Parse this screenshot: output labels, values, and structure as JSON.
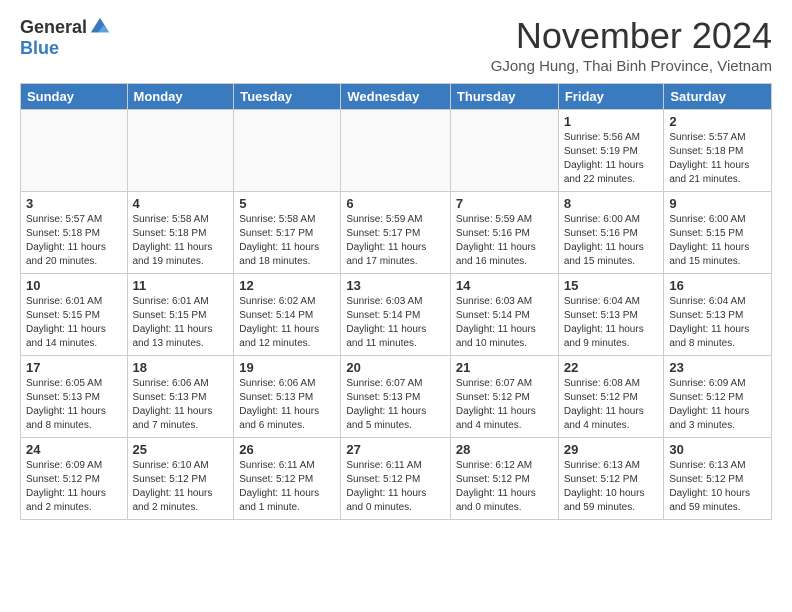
{
  "logo": {
    "general": "General",
    "blue": "Blue"
  },
  "header": {
    "month": "November 2024",
    "location": "GJong Hung, Thai Binh Province, Vietnam"
  },
  "days_of_week": [
    "Sunday",
    "Monday",
    "Tuesday",
    "Wednesday",
    "Thursday",
    "Friday",
    "Saturday"
  ],
  "weeks": [
    {
      "days": [
        {
          "num": "",
          "info": "",
          "empty": true
        },
        {
          "num": "",
          "info": "",
          "empty": true
        },
        {
          "num": "",
          "info": "",
          "empty": true
        },
        {
          "num": "",
          "info": "",
          "empty": true
        },
        {
          "num": "",
          "info": "",
          "empty": true
        },
        {
          "num": "1",
          "info": "Sunrise: 5:56 AM\nSunset: 5:19 PM\nDaylight: 11 hours\nand 22 minutes."
        },
        {
          "num": "2",
          "info": "Sunrise: 5:57 AM\nSunset: 5:18 PM\nDaylight: 11 hours\nand 21 minutes."
        }
      ]
    },
    {
      "days": [
        {
          "num": "3",
          "info": "Sunrise: 5:57 AM\nSunset: 5:18 PM\nDaylight: 11 hours\nand 20 minutes."
        },
        {
          "num": "4",
          "info": "Sunrise: 5:58 AM\nSunset: 5:18 PM\nDaylight: 11 hours\nand 19 minutes."
        },
        {
          "num": "5",
          "info": "Sunrise: 5:58 AM\nSunset: 5:17 PM\nDaylight: 11 hours\nand 18 minutes."
        },
        {
          "num": "6",
          "info": "Sunrise: 5:59 AM\nSunset: 5:17 PM\nDaylight: 11 hours\nand 17 minutes."
        },
        {
          "num": "7",
          "info": "Sunrise: 5:59 AM\nSunset: 5:16 PM\nDaylight: 11 hours\nand 16 minutes."
        },
        {
          "num": "8",
          "info": "Sunrise: 6:00 AM\nSunset: 5:16 PM\nDaylight: 11 hours\nand 15 minutes."
        },
        {
          "num": "9",
          "info": "Sunrise: 6:00 AM\nSunset: 5:15 PM\nDaylight: 11 hours\nand 15 minutes."
        }
      ]
    },
    {
      "days": [
        {
          "num": "10",
          "info": "Sunrise: 6:01 AM\nSunset: 5:15 PM\nDaylight: 11 hours\nand 14 minutes."
        },
        {
          "num": "11",
          "info": "Sunrise: 6:01 AM\nSunset: 5:15 PM\nDaylight: 11 hours\nand 13 minutes."
        },
        {
          "num": "12",
          "info": "Sunrise: 6:02 AM\nSunset: 5:14 PM\nDaylight: 11 hours\nand 12 minutes."
        },
        {
          "num": "13",
          "info": "Sunrise: 6:03 AM\nSunset: 5:14 PM\nDaylight: 11 hours\nand 11 minutes."
        },
        {
          "num": "14",
          "info": "Sunrise: 6:03 AM\nSunset: 5:14 PM\nDaylight: 11 hours\nand 10 minutes."
        },
        {
          "num": "15",
          "info": "Sunrise: 6:04 AM\nSunset: 5:13 PM\nDaylight: 11 hours\nand 9 minutes."
        },
        {
          "num": "16",
          "info": "Sunrise: 6:04 AM\nSunset: 5:13 PM\nDaylight: 11 hours\nand 8 minutes."
        }
      ]
    },
    {
      "days": [
        {
          "num": "17",
          "info": "Sunrise: 6:05 AM\nSunset: 5:13 PM\nDaylight: 11 hours\nand 8 minutes."
        },
        {
          "num": "18",
          "info": "Sunrise: 6:06 AM\nSunset: 5:13 PM\nDaylight: 11 hours\nand 7 minutes."
        },
        {
          "num": "19",
          "info": "Sunrise: 6:06 AM\nSunset: 5:13 PM\nDaylight: 11 hours\nand 6 minutes."
        },
        {
          "num": "20",
          "info": "Sunrise: 6:07 AM\nSunset: 5:13 PM\nDaylight: 11 hours\nand 5 minutes."
        },
        {
          "num": "21",
          "info": "Sunrise: 6:07 AM\nSunset: 5:12 PM\nDaylight: 11 hours\nand 4 minutes."
        },
        {
          "num": "22",
          "info": "Sunrise: 6:08 AM\nSunset: 5:12 PM\nDaylight: 11 hours\nand 4 minutes."
        },
        {
          "num": "23",
          "info": "Sunrise: 6:09 AM\nSunset: 5:12 PM\nDaylight: 11 hours\nand 3 minutes."
        }
      ]
    },
    {
      "days": [
        {
          "num": "24",
          "info": "Sunrise: 6:09 AM\nSunset: 5:12 PM\nDaylight: 11 hours\nand 2 minutes."
        },
        {
          "num": "25",
          "info": "Sunrise: 6:10 AM\nSunset: 5:12 PM\nDaylight: 11 hours\nand 2 minutes."
        },
        {
          "num": "26",
          "info": "Sunrise: 6:11 AM\nSunset: 5:12 PM\nDaylight: 11 hours\nand 1 minute."
        },
        {
          "num": "27",
          "info": "Sunrise: 6:11 AM\nSunset: 5:12 PM\nDaylight: 11 hours\nand 0 minutes."
        },
        {
          "num": "28",
          "info": "Sunrise: 6:12 AM\nSunset: 5:12 PM\nDaylight: 11 hours\nand 0 minutes."
        },
        {
          "num": "29",
          "info": "Sunrise: 6:13 AM\nSunset: 5:12 PM\nDaylight: 10 hours\nand 59 minutes."
        },
        {
          "num": "30",
          "info": "Sunrise: 6:13 AM\nSunset: 5:12 PM\nDaylight: 10 hours\nand 59 minutes."
        }
      ]
    }
  ]
}
